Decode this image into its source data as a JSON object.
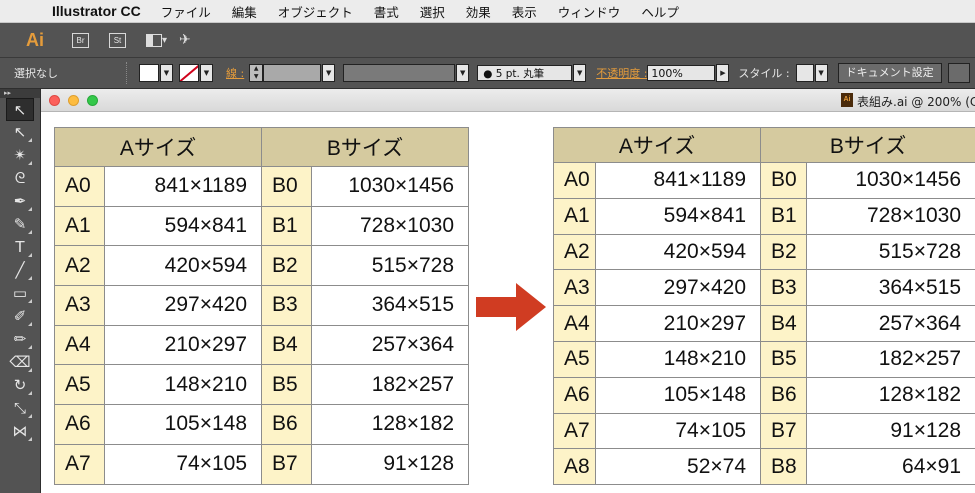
{
  "menubar": {
    "apple": "",
    "app_name": "Illustrator CC",
    "items": [
      "ファイル",
      "編集",
      "オブジェクト",
      "書式",
      "選択",
      "効果",
      "表示",
      "ウィンドウ",
      "ヘルプ"
    ]
  },
  "appbar": {
    "logo": "Ai",
    "bridge": "Br",
    "stock": "St"
  },
  "controlbar": {
    "selection": "選択なし",
    "stroke_label": "線 :",
    "brush": "5 pt. 丸筆",
    "opacity_label": "不透明度 :",
    "opacity_value": "100%",
    "style_label": "スタイル :",
    "doc_settings": "ドキュメント設定"
  },
  "document": {
    "title": "表組み.ai @ 200% (C"
  },
  "colors": {
    "header_bg": "#d5ca9f",
    "code_bg": "#fdf3c8",
    "arrow": "#d03c22"
  },
  "table_left": {
    "headers": [
      "Aサイズ",
      "Bサイズ"
    ],
    "rows": [
      [
        "A0",
        "841×1189",
        "B0",
        "1030×1456"
      ],
      [
        "A1",
        "594×841",
        "B1",
        "728×1030"
      ],
      [
        "A2",
        "420×594",
        "B2",
        "515×728"
      ],
      [
        "A3",
        "297×420",
        "B3",
        "364×515"
      ],
      [
        "A4",
        "210×297",
        "B4",
        "257×364"
      ],
      [
        "A5",
        "148×210",
        "B5",
        "182×257"
      ],
      [
        "A6",
        "105×148",
        "B6",
        "128×182"
      ],
      [
        "A7",
        "74×105",
        "B7",
        "91×128"
      ]
    ]
  },
  "table_right": {
    "headers": [
      "Aサイズ",
      "Bサイズ"
    ],
    "rows": [
      [
        "A0",
        "841×1189",
        "B0",
        "1030×1456"
      ],
      [
        "A1",
        "594×841",
        "B1",
        "728×1030"
      ],
      [
        "A2",
        "420×594",
        "B2",
        "515×728"
      ],
      [
        "A3",
        "297×420",
        "B3",
        "364×515"
      ],
      [
        "A4",
        "210×297",
        "B4",
        "257×364"
      ],
      [
        "A5",
        "148×210",
        "B5",
        "182×257"
      ],
      [
        "A6",
        "105×148",
        "B6",
        "128×182"
      ],
      [
        "A7",
        "74×105",
        "B7",
        "91×128"
      ],
      [
        "A8",
        "52×74",
        "B8",
        "64×91"
      ]
    ]
  }
}
